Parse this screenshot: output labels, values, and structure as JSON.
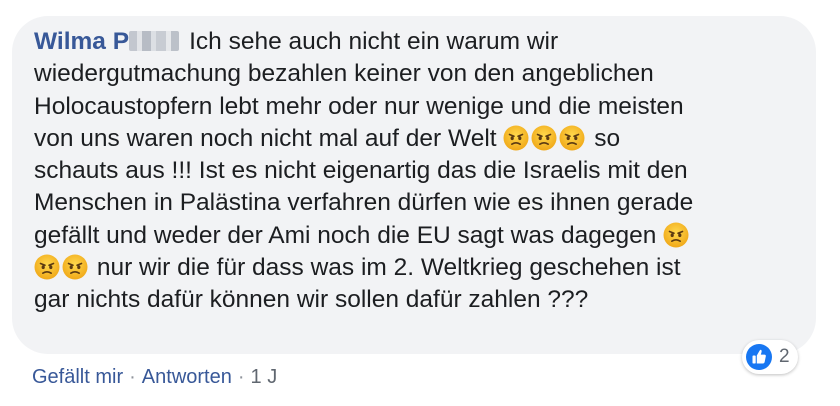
{
  "comment": {
    "author_visible": "Wilma P",
    "text_line1": "Ich sehe auch nicht ein warum wir",
    "text_line2": "wiedergutmachung bezahlen keiner von den angeblichen",
    "text_line3": "Holocaustopfern lebt mehr oder nur wenige und die meisten",
    "text_line4": "von uns waren noch nicht mal auf der Welt",
    "text_line4b": "so",
    "text_line5": "schauts aus !!! Ist es nicht eigenartig das die Israelis mit den",
    "text_line6": "Menschen in Palästina verfahren dürfen wie es ihnen gerade",
    "text_line7": "gefällt und weder der Ami noch die EU sagt was dagegen",
    "text_line8": "nur wir die für dass was im 2. Weltkrieg geschehen ist",
    "text_line9": "gar nichts dafür können wir sollen dafür zahlen ???",
    "emoji": "angry-face-icon"
  },
  "reactions": {
    "icon": "like-thumb-icon",
    "count": "2",
    "colors": {
      "like": "#1877f2"
    }
  },
  "actions": {
    "like_label": "Gefällt mir",
    "reply_label": "Antworten",
    "separator": "·",
    "timestamp": "1 J"
  },
  "colors": {
    "author": "#385898",
    "bubble": "#f2f3f5",
    "text": "#1c1e21",
    "meta": "#606770"
  }
}
